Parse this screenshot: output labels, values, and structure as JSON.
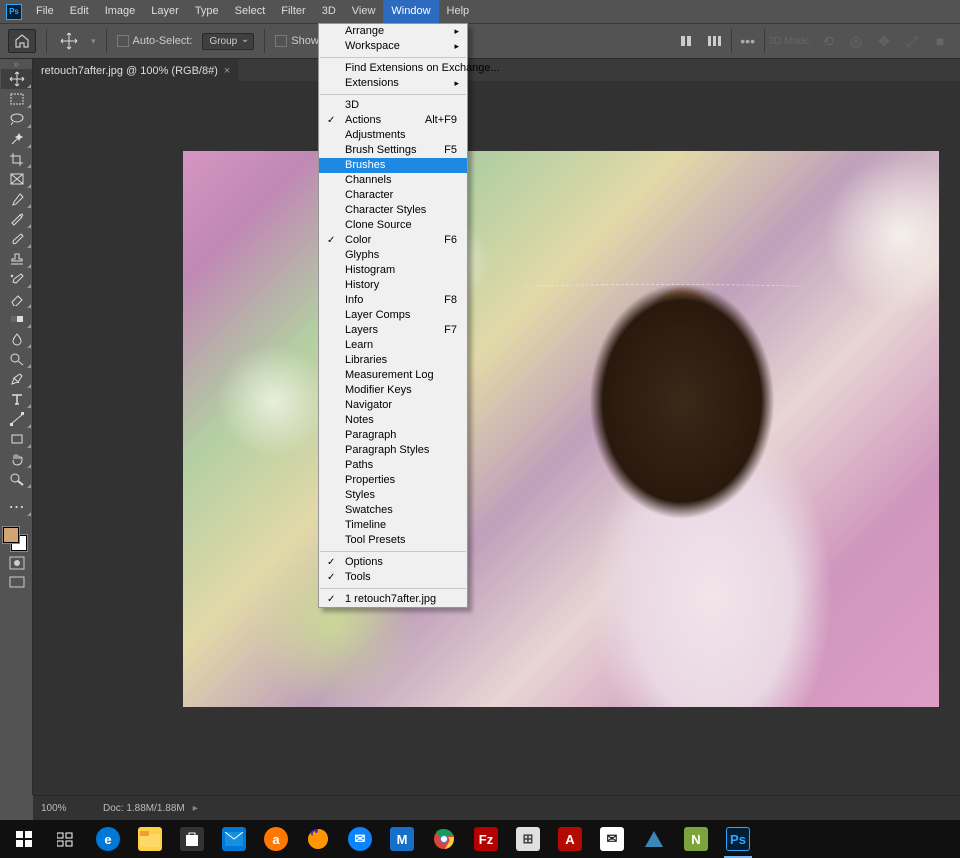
{
  "menubar": [
    "File",
    "Edit",
    "Image",
    "Layer",
    "Type",
    "Select",
    "Filter",
    "3D",
    "View",
    "Window",
    "Help"
  ],
  "menubar_active_index": 9,
  "optbar": {
    "auto_select": "Auto-Select:",
    "group": "Group",
    "show_transform": "Show Transform Controls",
    "mode_label": "3D Mode:"
  },
  "tab": {
    "title": "retouch7after.jpg @ 100% (RGB/8#)"
  },
  "dropdown": {
    "sections": [
      [
        {
          "label": "Arrange",
          "arrow": true
        },
        {
          "label": "Workspace",
          "arrow": true
        }
      ],
      [
        {
          "label": "Find Extensions on Exchange..."
        },
        {
          "label": "Extensions",
          "arrow": true
        }
      ],
      [
        {
          "label": "3D"
        },
        {
          "label": "Actions",
          "check": true,
          "shortcut": "Alt+F9"
        },
        {
          "label": "Adjustments"
        },
        {
          "label": "Brush Settings",
          "shortcut": "F5"
        },
        {
          "label": "Brushes",
          "highlight": true
        },
        {
          "label": "Channels"
        },
        {
          "label": "Character"
        },
        {
          "label": "Character Styles"
        },
        {
          "label": "Clone Source"
        },
        {
          "label": "Color",
          "check": true,
          "shortcut": "F6"
        },
        {
          "label": "Glyphs"
        },
        {
          "label": "Histogram"
        },
        {
          "label": "History"
        },
        {
          "label": "Info",
          "shortcut": "F8"
        },
        {
          "label": "Layer Comps"
        },
        {
          "label": "Layers",
          "shortcut": "F7"
        },
        {
          "label": "Learn"
        },
        {
          "label": "Libraries"
        },
        {
          "label": "Measurement Log"
        },
        {
          "label": "Modifier Keys"
        },
        {
          "label": "Navigator"
        },
        {
          "label": "Notes"
        },
        {
          "label": "Paragraph"
        },
        {
          "label": "Paragraph Styles"
        },
        {
          "label": "Paths"
        },
        {
          "label": "Properties"
        },
        {
          "label": "Styles"
        },
        {
          "label": "Swatches"
        },
        {
          "label": "Timeline"
        },
        {
          "label": "Tool Presets"
        }
      ],
      [
        {
          "label": "Options",
          "check": true
        },
        {
          "label": "Tools",
          "check": true
        }
      ],
      [
        {
          "label": "1 retouch7after.jpg",
          "check": true
        }
      ]
    ]
  },
  "status": {
    "zoom": "100%",
    "doc": "Doc: 1.88M/1.88M"
  },
  "tools": [
    "move",
    "marquee",
    "lasso",
    "wand",
    "crop",
    "frame",
    "eyedrop",
    "patch",
    "brush",
    "stamp",
    "history-brush",
    "eraser",
    "gradient",
    "blur",
    "dodge",
    "pen",
    "type",
    "path",
    "shape",
    "hand",
    "zoom"
  ],
  "taskbar": [
    "start",
    "tasks",
    "edge",
    "explorer",
    "store",
    "mail",
    "avast",
    "firefox",
    "thunderbird",
    "malwarebytes",
    "chrome",
    "filezilla",
    "apps",
    "acrobat",
    "outlook",
    "zotero",
    "onenote",
    "photoshop"
  ]
}
